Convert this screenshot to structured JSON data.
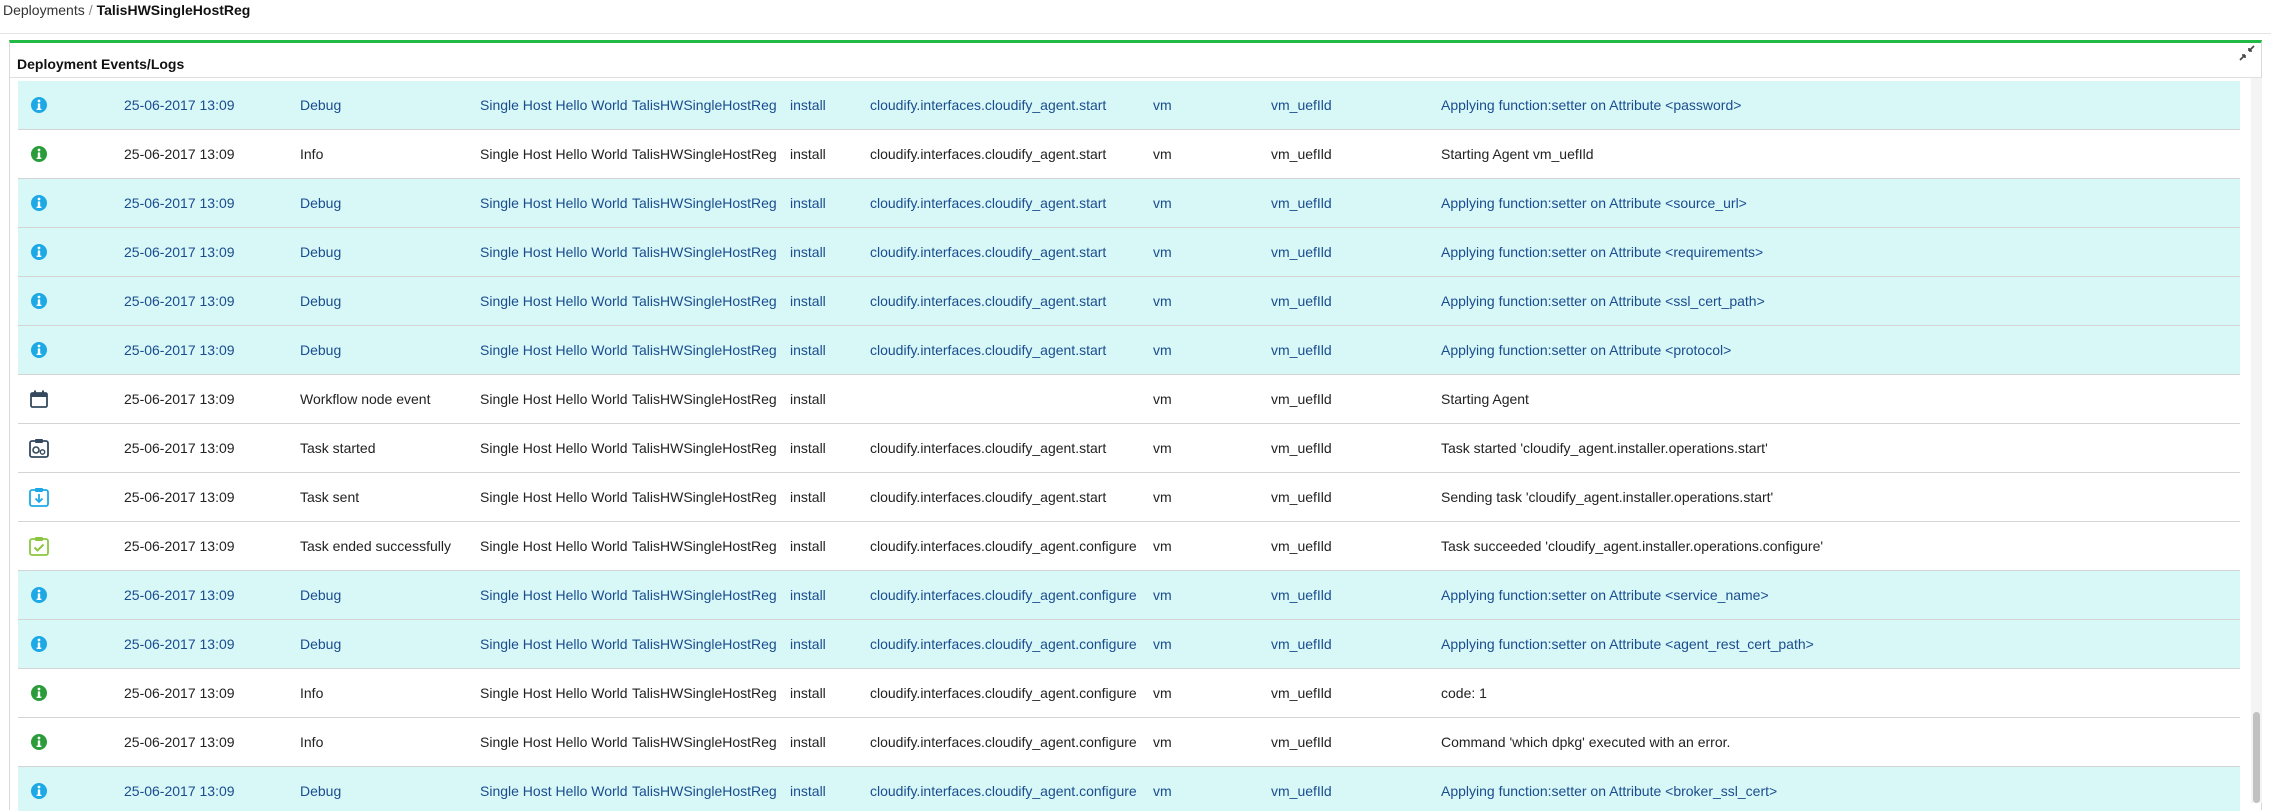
{
  "breadcrumb": {
    "root": "Deployments",
    "separator": "/",
    "current": "TalisHWSingleHostReg"
  },
  "widget": {
    "title": "Deployment Events/Logs",
    "compress_icon": "compress-icon"
  },
  "colors": {
    "accent_green": "#21ba45",
    "debug_row_bg": "#d8f7f7",
    "debug_text": "#1a4d8f",
    "info_icon": "#2a9d3a",
    "debug_icon": "#1ca9e6",
    "event_icon_dark": "#34495e",
    "event_icon_blue": "#1ca9e6",
    "event_icon_green": "#8cc63f"
  },
  "rows": [
    {
      "icon": "info-debug-icon",
      "kind": "debug",
      "timestamp": "25-06-2017 13:09",
      "type": "Debug",
      "blueprint": "Single Host Hello World",
      "deployment": "TalisHWSingleHostReg",
      "workflow": "install",
      "operation": "cloudify.interfaces.cloudify_agent.start",
      "node": "vm",
      "instance": "vm_uefIld",
      "message": "Applying function:setter on Attribute <password>"
    },
    {
      "icon": "info-icon",
      "kind": "normal",
      "timestamp": "25-06-2017 13:09",
      "type": "Info",
      "blueprint": "Single Host Hello World",
      "deployment": "TalisHWSingleHostReg",
      "workflow": "install",
      "operation": "cloudify.interfaces.cloudify_agent.start",
      "node": "vm",
      "instance": "vm_uefIld",
      "message": "Starting Agent vm_uefIld"
    },
    {
      "icon": "info-debug-icon",
      "kind": "debug",
      "timestamp": "25-06-2017 13:09",
      "type": "Debug",
      "blueprint": "Single Host Hello World",
      "deployment": "TalisHWSingleHostReg",
      "workflow": "install",
      "operation": "cloudify.interfaces.cloudify_agent.start",
      "node": "vm",
      "instance": "vm_uefIld",
      "message": "Applying function:setter on Attribute <source_url>"
    },
    {
      "icon": "info-debug-icon",
      "kind": "debug",
      "timestamp": "25-06-2017 13:09",
      "type": "Debug",
      "blueprint": "Single Host Hello World",
      "deployment": "TalisHWSingleHostReg",
      "workflow": "install",
      "operation": "cloudify.interfaces.cloudify_agent.start",
      "node": "vm",
      "instance": "vm_uefIld",
      "message": "Applying function:setter on Attribute <requirements>"
    },
    {
      "icon": "info-debug-icon",
      "kind": "debug",
      "timestamp": "25-06-2017 13:09",
      "type": "Debug",
      "blueprint": "Single Host Hello World",
      "deployment": "TalisHWSingleHostReg",
      "workflow": "install",
      "operation": "cloudify.interfaces.cloudify_agent.start",
      "node": "vm",
      "instance": "vm_uefIld",
      "message": "Applying function:setter on Attribute <ssl_cert_path>"
    },
    {
      "icon": "info-debug-icon",
      "kind": "debug",
      "timestamp": "25-06-2017 13:09",
      "type": "Debug",
      "blueprint": "Single Host Hello World",
      "deployment": "TalisHWSingleHostReg",
      "workflow": "install",
      "operation": "cloudify.interfaces.cloudify_agent.start",
      "node": "vm",
      "instance": "vm_uefIld",
      "message": "Applying function:setter on Attribute <protocol>"
    },
    {
      "icon": "calendar-icon",
      "kind": "normal",
      "timestamp": "25-06-2017 13:09",
      "type": "Workflow node event",
      "blueprint": "Single Host Hello World",
      "deployment": "TalisHWSingleHostReg",
      "workflow": "install",
      "operation": "",
      "node": "vm",
      "instance": "vm_uefIld",
      "message": "Starting Agent"
    },
    {
      "icon": "task-started-icon",
      "kind": "normal",
      "timestamp": "25-06-2017 13:09",
      "type": "Task started",
      "blueprint": "Single Host Hello World",
      "deployment": "TalisHWSingleHostReg",
      "workflow": "install",
      "operation": "cloudify.interfaces.cloudify_agent.start",
      "node": "vm",
      "instance": "vm_uefIld",
      "message": "Task started 'cloudify_agent.installer.operations.start'"
    },
    {
      "icon": "task-sent-icon",
      "kind": "normal",
      "timestamp": "25-06-2017 13:09",
      "type": "Task sent",
      "blueprint": "Single Host Hello World",
      "deployment": "TalisHWSingleHostReg",
      "workflow": "install",
      "operation": "cloudify.interfaces.cloudify_agent.start",
      "node": "vm",
      "instance": "vm_uefIld",
      "message": "Sending task 'cloudify_agent.installer.operations.start'"
    },
    {
      "icon": "task-success-icon",
      "kind": "normal",
      "timestamp": "25-06-2017 13:09",
      "type": "Task ended successfully",
      "blueprint": "Single Host Hello World",
      "deployment": "TalisHWSingleHostReg",
      "workflow": "install",
      "operation": "cloudify.interfaces.cloudify_agent.configure",
      "node": "vm",
      "instance": "vm_uefIld",
      "message": "Task succeeded 'cloudify_agent.installer.operations.configure'"
    },
    {
      "icon": "info-debug-icon",
      "kind": "debug",
      "timestamp": "25-06-2017 13:09",
      "type": "Debug",
      "blueprint": "Single Host Hello World",
      "deployment": "TalisHWSingleHostReg",
      "workflow": "install",
      "operation": "cloudify.interfaces.cloudify_agent.configure",
      "node": "vm",
      "instance": "vm_uefIld",
      "message": "Applying function:setter on Attribute <service_name>"
    },
    {
      "icon": "info-debug-icon",
      "kind": "debug",
      "timestamp": "25-06-2017 13:09",
      "type": "Debug",
      "blueprint": "Single Host Hello World",
      "deployment": "TalisHWSingleHostReg",
      "workflow": "install",
      "operation": "cloudify.interfaces.cloudify_agent.configure",
      "node": "vm",
      "instance": "vm_uefIld",
      "message": "Applying function:setter on Attribute <agent_rest_cert_path>"
    },
    {
      "icon": "info-icon",
      "kind": "normal",
      "timestamp": "25-06-2017 13:09",
      "type": "Info",
      "blueprint": "Single Host Hello World",
      "deployment": "TalisHWSingleHostReg",
      "workflow": "install",
      "operation": "cloudify.interfaces.cloudify_agent.configure",
      "node": "vm",
      "instance": "vm_uefIld",
      "message": "code: 1"
    },
    {
      "icon": "info-icon",
      "kind": "normal",
      "timestamp": "25-06-2017 13:09",
      "type": "Info",
      "blueprint": "Single Host Hello World",
      "deployment": "TalisHWSingleHostReg",
      "workflow": "install",
      "operation": "cloudify.interfaces.cloudify_agent.configure",
      "node": "vm",
      "instance": "vm_uefIld",
      "message": "Command 'which dpkg' executed with an error."
    },
    {
      "icon": "info-debug-icon",
      "kind": "debug",
      "timestamp": "25-06-2017 13:09",
      "type": "Debug",
      "blueprint": "Single Host Hello World",
      "deployment": "TalisHWSingleHostReg",
      "workflow": "install",
      "operation": "cloudify.interfaces.cloudify_agent.configure",
      "node": "vm",
      "instance": "vm_uefIld",
      "message": "Applying function:setter on Attribute <broker_ssl_cert>"
    }
  ]
}
